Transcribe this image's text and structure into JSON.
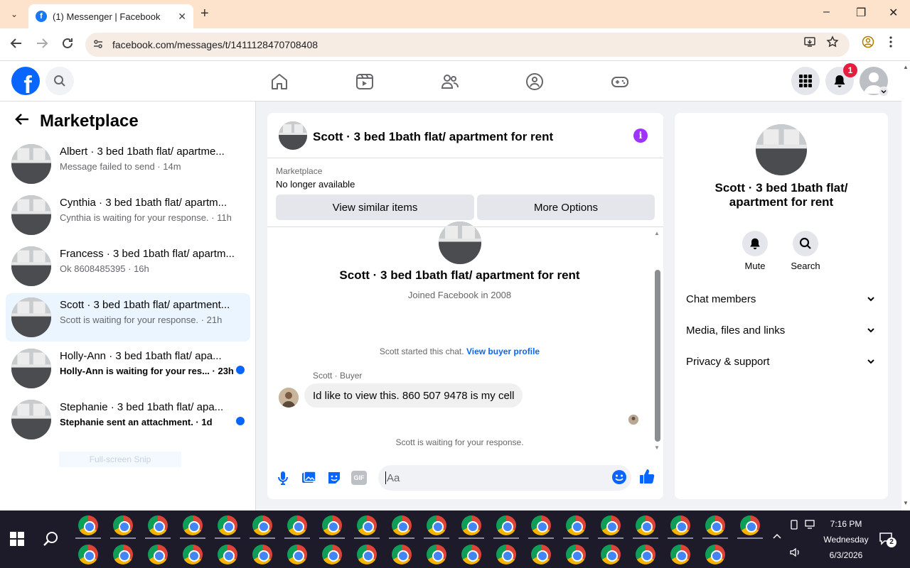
{
  "browser": {
    "tab_title": "(1) Messenger | Facebook",
    "url": "facebook.com/messages/t/1411128470708408",
    "minimize": "–",
    "restore": "❐",
    "close": "✕",
    "new_tab": "+",
    "tab_close": "✕",
    "tab_menu": "⌄"
  },
  "header": {
    "logo": "f",
    "notification_count": "1"
  },
  "left": {
    "title": "Marketplace",
    "conversations": [
      {
        "name": "Albert · 3 bed 1bath flat/ apartme...",
        "snippet": "Message failed to send · 14m",
        "unread": false,
        "bold": false
      },
      {
        "name": "Cynthia · 3 bed 1bath flat/ apartm...",
        "snippet": "Cynthia is waiting for your response. · 11h",
        "unread": false,
        "bold": false
      },
      {
        "name": "Francess · 3 bed 1bath flat/ apartm...",
        "snippet": "Ok 8608485395 · 16h",
        "unread": false,
        "bold": false
      },
      {
        "name": "Scott · 3 bed 1bath flat/ apartment...",
        "snippet": "Scott is waiting for your response. · 21h",
        "unread": false,
        "bold": false,
        "active": true
      },
      {
        "name": "Holly-Ann · 3 bed 1bath flat/ apa...",
        "snippet": "Holly-Ann is waiting for your res... · 23h",
        "unread": true,
        "bold": true
      },
      {
        "name": "Stephanie · 3 bed 1bath flat/ apa...",
        "snippet": "Stephanie sent an attachment. · 1d",
        "unread": true,
        "bold": true
      }
    ],
    "snip_overlay": "Full-screen Snip"
  },
  "chat": {
    "title": "Scott · 3 bed 1bath flat/ apartment for rent",
    "marketplace_label": "Marketplace",
    "marketplace_status": "No longer available",
    "btn_similar": "View similar items",
    "btn_more": "More Options",
    "joined": "Joined Facebook in 2008",
    "started_text": "Scott started this chat.",
    "started_link": "View buyer profile",
    "sender": "Scott · Buyer",
    "message": "Id like to view this. 860 507 9478 is my cell",
    "waiting": "Scott is waiting for your response.",
    "composer_placeholder": "Aa",
    "gif_label": "GIF"
  },
  "right": {
    "title": "Scott · 3 bed 1bath flat/ apartment for rent",
    "mute_label": "Mute",
    "search_label": "Search",
    "sections": [
      "Chat members",
      "Media, files and links",
      "Privacy & support"
    ]
  },
  "taskbar": {
    "time": "7:16 PM",
    "day": "Wednesday",
    "date": "6/3/2026",
    "notif_count": "2"
  },
  "colors": {
    "fb_blue": "#0866ff",
    "active_conv_bg": "#ebf5ff",
    "info_purple": "#a033ff",
    "notification_red": "#e41e3f"
  }
}
